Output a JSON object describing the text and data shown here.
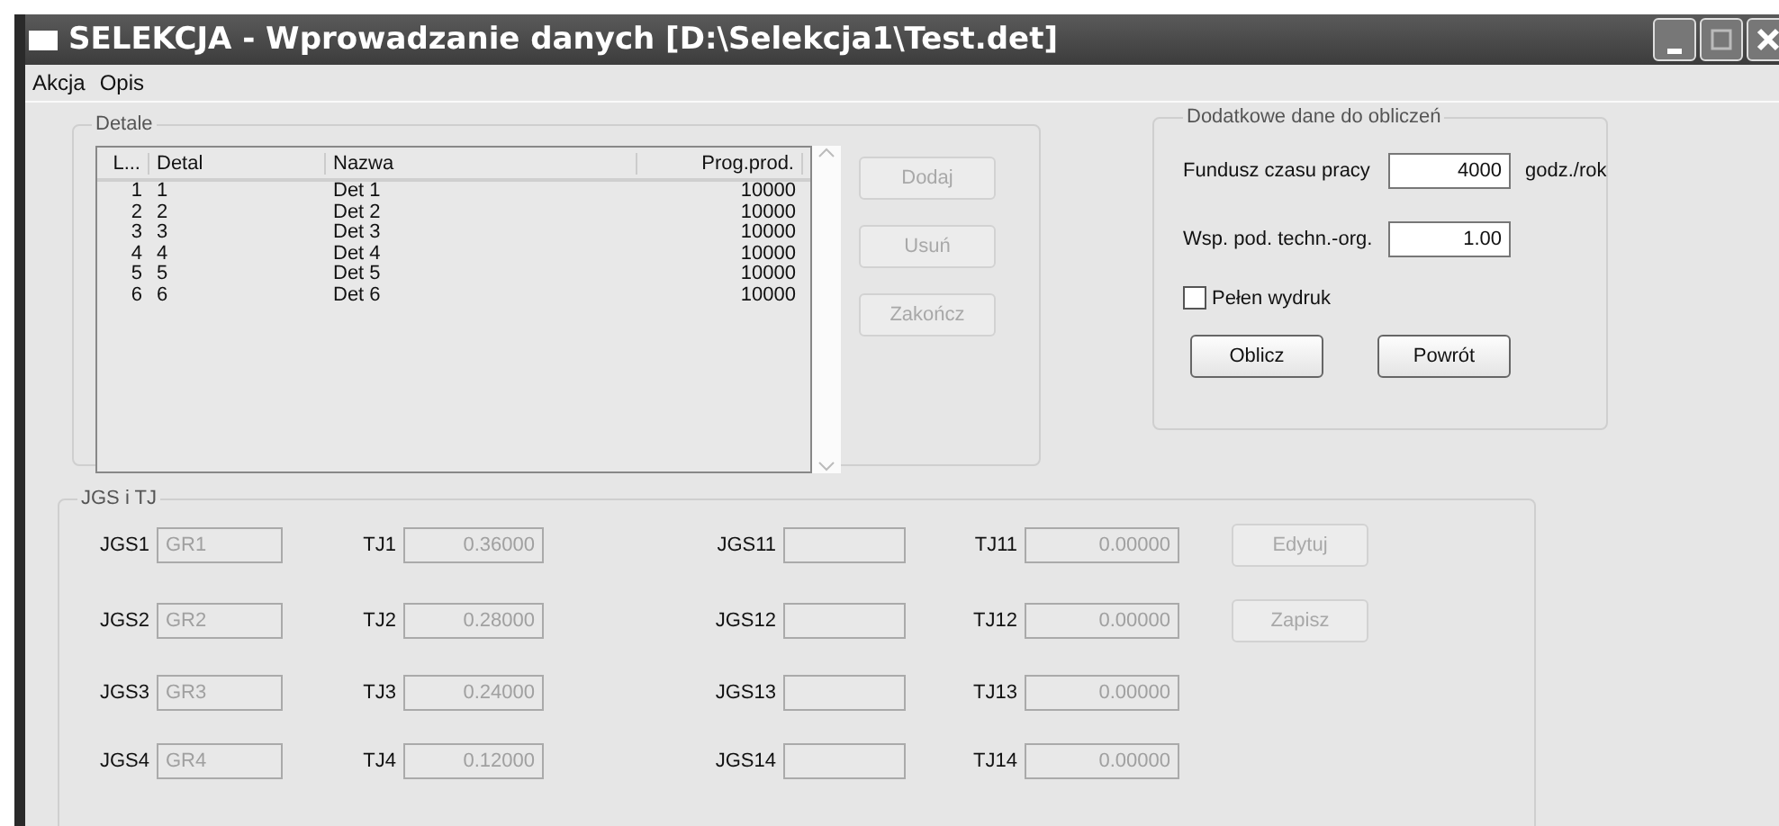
{
  "window": {
    "title": "SELEKCJA - Wprowadzanie danych [D:\\Selekcja1\\Test.det]"
  },
  "menu": [
    {
      "label": "Akcja"
    },
    {
      "label": "Opis"
    }
  ],
  "detale": {
    "title": "Detale",
    "columns": [
      "L...",
      "Detal",
      "Nazwa",
      "Prog.prod."
    ],
    "rows": [
      [
        "1",
        "1",
        "Det 1",
        "10000"
      ],
      [
        "2",
        "2",
        "Det 2",
        "10000"
      ],
      [
        "3",
        "3",
        "Det 3",
        "10000"
      ],
      [
        "4",
        "4",
        "Det 4",
        "10000"
      ],
      [
        "5",
        "5",
        "Det 5",
        "10000"
      ],
      [
        "6",
        "6",
        "Det 6",
        "10000"
      ]
    ],
    "buttons": [
      {
        "label": "Dodaj",
        "disabled": true
      },
      {
        "label": "Usuń",
        "disabled": true
      },
      {
        "label": "Zakończ",
        "disabled": true
      }
    ]
  },
  "dodatkowe": {
    "title": "Dodatkowe dane do obliczeń",
    "fields": [
      {
        "label": "Fundusz czasu pracy",
        "value": "4000",
        "unit": "godz./rok"
      },
      {
        "label": "Wsp. pod. techn.-org.",
        "value": "1.00"
      }
    ],
    "checkbox": {
      "label": "Pełen wydruk",
      "checked": false
    },
    "buttons": [
      {
        "label": "Oblicz"
      },
      {
        "label": "Powrót"
      }
    ]
  },
  "jgs_tj": {
    "title": "JGS i TJ",
    "rows": [
      {
        "jgs_label": "JGS1",
        "jgs_value": "GR1",
        "tj_label": "TJ1",
        "tj_value": "0.36000",
        "jgs2_label": "JGS11",
        "tj2_label": "TJ11",
        "tj2_value": "0.00000",
        "disabled": true
      },
      {
        "jgs_label": "JGS2",
        "jgs_value": "GR2",
        "tj_label": "TJ2",
        "tj_value": "0.28000",
        "jgs2_label": "JGS12",
        "tj2_label": "TJ12",
        "tj2_value": "0.00000",
        "disabled": true
      },
      {
        "jgs_label": "JGS3",
        "jgs_value": "GR3",
        "tj_label": "TJ3",
        "tj_value": "0.24000",
        "jgs2_label": "JGS13",
        "tj2_label": "TJ13",
        "tj2_value": "0.00000",
        "disabled": true
      },
      {
        "jgs_label": "JGS4",
        "jgs_value": "GR4",
        "tj_label": "TJ4",
        "tj_value": "0.12000",
        "jgs2_label": "JGS14",
        "tj2_label": "TJ14",
        "tj2_value": "0.00000",
        "disabled": true
      }
    ],
    "buttons": [
      {
        "label": "Edytuj",
        "disabled": true
      },
      {
        "label": "Zapisz",
        "disabled": true
      }
    ]
  }
}
